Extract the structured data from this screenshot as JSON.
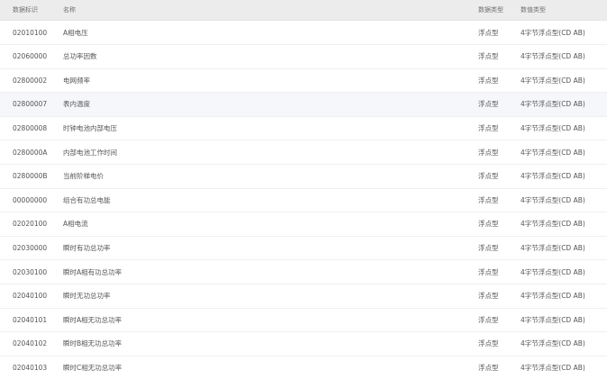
{
  "table": {
    "headers": {
      "id": "数据标识",
      "name": "名称",
      "data_type": "数据类型",
      "value_type": "数值类型"
    },
    "rows": [
      {
        "id": "02010100",
        "name": "A相电压",
        "data_type": "浮点型",
        "value_type": "4字节浮点型(CD AB)"
      },
      {
        "id": "02060000",
        "name": "总功率因数",
        "data_type": "浮点型",
        "value_type": "4字节浮点型(CD AB)"
      },
      {
        "id": "02800002",
        "name": "电网频率",
        "data_type": "浮点型",
        "value_type": "4字节浮点型(CD AB)"
      },
      {
        "id": "02800007",
        "name": "表内温度",
        "data_type": "浮点型",
        "value_type": "4字节浮点型(CD AB)"
      },
      {
        "id": "02800008",
        "name": "时钟电池内部电压",
        "data_type": "浮点型",
        "value_type": "4字节浮点型(CD AB)"
      },
      {
        "id": "0280000A",
        "name": "内部电池工作时间",
        "data_type": "浮点型",
        "value_type": "4字节浮点型(CD AB)"
      },
      {
        "id": "0280000B",
        "name": "当前阶梯电价",
        "data_type": "浮点型",
        "value_type": "4字节浮点型(CD AB)"
      },
      {
        "id": "00000000",
        "name": "组合有功总电能",
        "data_type": "浮点型",
        "value_type": "4字节浮点型(CD AB)"
      },
      {
        "id": "02020100",
        "name": "A相电流",
        "data_type": "浮点型",
        "value_type": "4字节浮点型(CD AB)"
      },
      {
        "id": "02030000",
        "name": "瞬时有功总功率",
        "data_type": "浮点型",
        "value_type": "4字节浮点型(CD AB)"
      },
      {
        "id": "02030100",
        "name": "瞬时A相有功总功率",
        "data_type": "浮点型",
        "value_type": "4字节浮点型(CD AB)"
      },
      {
        "id": "02040100",
        "name": "瞬时无功总功率",
        "data_type": "浮点型",
        "value_type": "4字节浮点型(CD AB)"
      },
      {
        "id": "02040101",
        "name": "瞬时A相无功总功率",
        "data_type": "浮点型",
        "value_type": "4字节浮点型(CD AB)"
      },
      {
        "id": "02040102",
        "name": "瞬时B相无功总功率",
        "data_type": "浮点型",
        "value_type": "4字节浮点型(CD AB)"
      },
      {
        "id": "02040103",
        "name": "瞬时C相无功总功率",
        "data_type": "浮点型",
        "value_type": "4字节浮点型(CD AB)"
      }
    ]
  }
}
